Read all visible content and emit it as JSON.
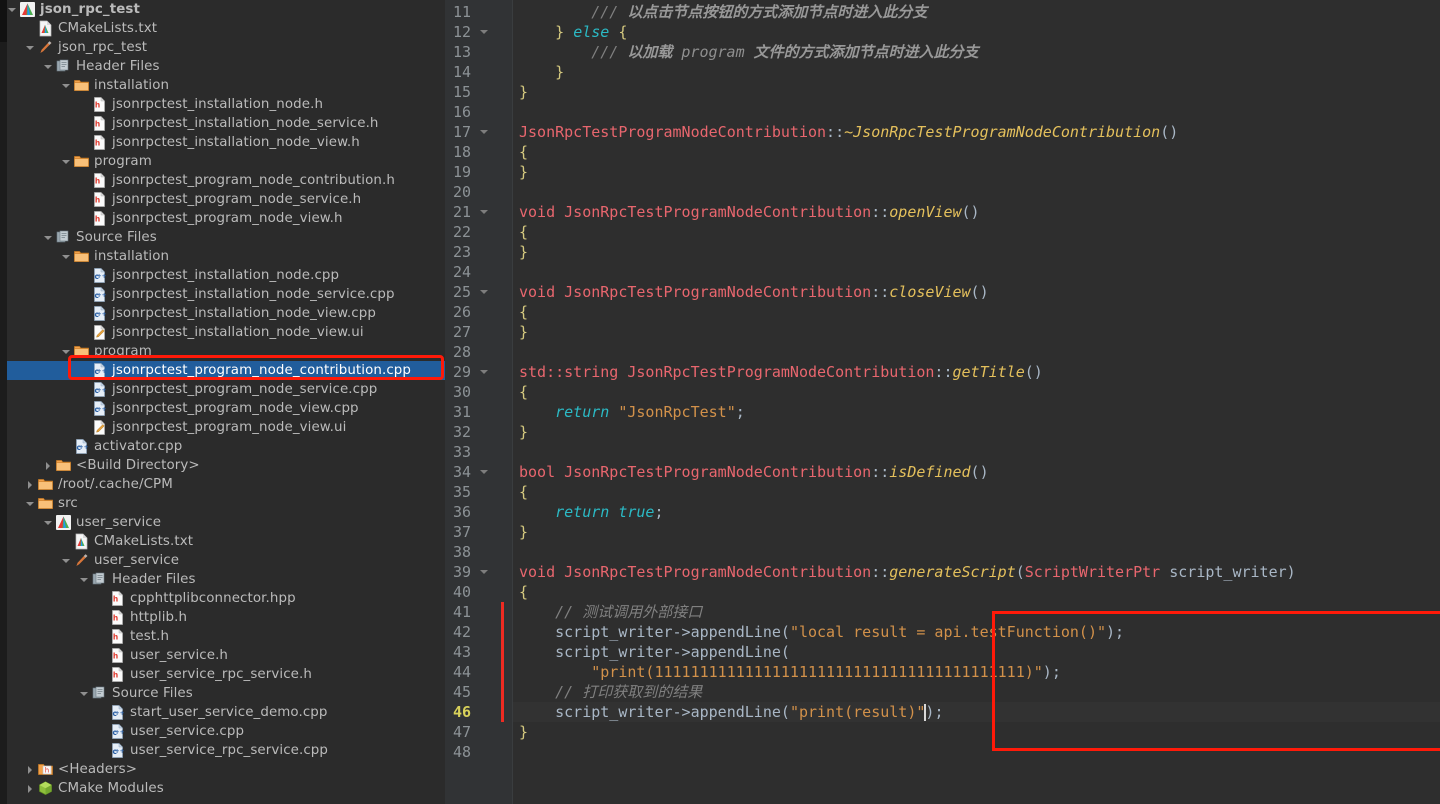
{
  "tree": {
    "rows": [
      {
        "indent": 0,
        "arrow": "down",
        "icon": "cmake-project-icon",
        "label": "json_rpc_test",
        "bold": true,
        "selected": false
      },
      {
        "indent": 1,
        "arrow": "none",
        "icon": "cmake-file-icon",
        "label": "CMakeLists.txt",
        "bold": false,
        "selected": false
      },
      {
        "indent": 1,
        "arrow": "down",
        "icon": "build-target-icon",
        "label": "json_rpc_test",
        "bold": false,
        "selected": false
      },
      {
        "indent": 2,
        "arrow": "down",
        "icon": "header-group-icon",
        "label": "Header Files",
        "bold": false,
        "selected": false
      },
      {
        "indent": 3,
        "arrow": "down",
        "icon": "folder-icon",
        "label": "installation",
        "bold": false,
        "selected": false
      },
      {
        "indent": 4,
        "arrow": "none",
        "icon": "h-file-icon",
        "label": "jsonrpctest_installation_node.h",
        "bold": false,
        "selected": false
      },
      {
        "indent": 4,
        "arrow": "none",
        "icon": "h-file-icon",
        "label": "jsonrpctest_installation_node_service.h",
        "bold": false,
        "selected": false
      },
      {
        "indent": 4,
        "arrow": "none",
        "icon": "h-file-icon",
        "label": "jsonrpctest_installation_node_view.h",
        "bold": false,
        "selected": false
      },
      {
        "indent": 3,
        "arrow": "down",
        "icon": "folder-icon",
        "label": "program",
        "bold": false,
        "selected": false
      },
      {
        "indent": 4,
        "arrow": "none",
        "icon": "h-file-icon",
        "label": "jsonrpctest_program_node_contribution.h",
        "bold": false,
        "selected": false
      },
      {
        "indent": 4,
        "arrow": "none",
        "icon": "h-file-icon",
        "label": "jsonrpctest_program_node_service.h",
        "bold": false,
        "selected": false
      },
      {
        "indent": 4,
        "arrow": "none",
        "icon": "h-file-icon",
        "label": "jsonrpctest_program_node_view.h",
        "bold": false,
        "selected": false
      },
      {
        "indent": 2,
        "arrow": "down",
        "icon": "source-group-icon",
        "label": "Source Files",
        "bold": false,
        "selected": false
      },
      {
        "indent": 3,
        "arrow": "down",
        "icon": "folder-icon",
        "label": "installation",
        "bold": false,
        "selected": false
      },
      {
        "indent": 4,
        "arrow": "none",
        "icon": "cpp-file-icon",
        "label": "jsonrpctest_installation_node.cpp",
        "bold": false,
        "selected": false
      },
      {
        "indent": 4,
        "arrow": "none",
        "icon": "cpp-file-icon",
        "label": "jsonrpctest_installation_node_service.cpp",
        "bold": false,
        "selected": false
      },
      {
        "indent": 4,
        "arrow": "none",
        "icon": "cpp-file-icon",
        "label": "jsonrpctest_installation_node_view.cpp",
        "bold": false,
        "selected": false
      },
      {
        "indent": 4,
        "arrow": "none",
        "icon": "ui-file-icon",
        "label": "jsonrpctest_installation_node_view.ui",
        "bold": false,
        "selected": false
      },
      {
        "indent": 3,
        "arrow": "down",
        "icon": "folder-icon",
        "label": "program",
        "bold": false,
        "selected": false
      },
      {
        "indent": 4,
        "arrow": "none",
        "icon": "cpp-file-icon",
        "label": "jsonrpctest_program_node_contribution.cpp",
        "bold": false,
        "selected": true
      },
      {
        "indent": 4,
        "arrow": "none",
        "icon": "cpp-file-icon",
        "label": "jsonrpctest_program_node_service.cpp",
        "bold": false,
        "selected": false
      },
      {
        "indent": 4,
        "arrow": "none",
        "icon": "cpp-file-icon",
        "label": "jsonrpctest_program_node_view.cpp",
        "bold": false,
        "selected": false
      },
      {
        "indent": 4,
        "arrow": "none",
        "icon": "ui-file-icon",
        "label": "jsonrpctest_program_node_view.ui",
        "bold": false,
        "selected": false
      },
      {
        "indent": 3,
        "arrow": "none",
        "icon": "cpp-file-icon",
        "label": "activator.cpp",
        "bold": false,
        "selected": false
      },
      {
        "indent": 2,
        "arrow": "right",
        "icon": "folder-icon",
        "label": "<Build Directory>",
        "bold": false,
        "selected": false
      },
      {
        "indent": 1,
        "arrow": "right",
        "icon": "folder-icon",
        "label": "/root/.cache/CPM",
        "bold": false,
        "selected": false
      },
      {
        "indent": 1,
        "arrow": "down",
        "icon": "folder-icon",
        "label": "src",
        "bold": false,
        "selected": false
      },
      {
        "indent": 2,
        "arrow": "down",
        "icon": "cmake-project-icon",
        "label": "user_service",
        "bold": false,
        "selected": false
      },
      {
        "indent": 3,
        "arrow": "none",
        "icon": "cmake-file-icon",
        "label": "CMakeLists.txt",
        "bold": false,
        "selected": false
      },
      {
        "indent": 3,
        "arrow": "down",
        "icon": "build-target-icon",
        "label": "user_service",
        "bold": false,
        "selected": false
      },
      {
        "indent": 4,
        "arrow": "down",
        "icon": "header-group-icon",
        "label": "Header Files",
        "bold": false,
        "selected": false
      },
      {
        "indent": 5,
        "arrow": "none",
        "icon": "h-file-icon",
        "label": "cpphttplibconnector.hpp",
        "bold": false,
        "selected": false
      },
      {
        "indent": 5,
        "arrow": "none",
        "icon": "h-file-icon",
        "label": "httplib.h",
        "bold": false,
        "selected": false
      },
      {
        "indent": 5,
        "arrow": "none",
        "icon": "h-file-icon",
        "label": "test.h",
        "bold": false,
        "selected": false
      },
      {
        "indent": 5,
        "arrow": "none",
        "icon": "h-file-icon",
        "label": "user_service.h",
        "bold": false,
        "selected": false
      },
      {
        "indent": 5,
        "arrow": "none",
        "icon": "h-file-icon",
        "label": "user_service_rpc_service.h",
        "bold": false,
        "selected": false
      },
      {
        "indent": 4,
        "arrow": "down",
        "icon": "source-group-icon",
        "label": "Source Files",
        "bold": false,
        "selected": false
      },
      {
        "indent": 5,
        "arrow": "none",
        "icon": "cpp-file-icon",
        "label": "start_user_service_demo.cpp",
        "bold": false,
        "selected": false
      },
      {
        "indent": 5,
        "arrow": "none",
        "icon": "cpp-file-icon",
        "label": "user_service.cpp",
        "bold": false,
        "selected": false
      },
      {
        "indent": 5,
        "arrow": "none",
        "icon": "cpp-file-icon",
        "label": "user_service_rpc_service.cpp",
        "bold": false,
        "selected": false
      },
      {
        "indent": 1,
        "arrow": "right",
        "icon": "headers-group-icon",
        "label": "<Headers>",
        "bold": false,
        "selected": false
      },
      {
        "indent": 1,
        "arrow": "right",
        "icon": "cmake-modules-icon",
        "label": "CMake Modules",
        "bold": false,
        "selected": false
      }
    ],
    "selection_highlight_color": "#215d9c",
    "annotation_box_color": "#ff1a09"
  },
  "editor": {
    "first_line_number": 11,
    "last_line_number": 48,
    "current_line_number": 46,
    "change_bar_color": "#ee2b22",
    "annotation_box_color": "#ff1a09",
    "lines": [
      {
        "n": 11,
        "fold": false,
        "tokens": [
          {
            "t": "        ",
            "c": "plain"
          },
          {
            "t": "/// ",
            "c": "cmt"
          },
          {
            "t": "以点击节点按钮的方式添加节点时进入此分支",
            "c": "docc"
          }
        ]
      },
      {
        "n": 12,
        "fold": true,
        "tokens": [
          {
            "t": "    ",
            "c": "plain"
          },
          {
            "t": "}",
            "c": "brace-y"
          },
          {
            "t": " ",
            "c": "plain"
          },
          {
            "t": "else",
            "c": "kw2"
          },
          {
            "t": " ",
            "c": "plain"
          },
          {
            "t": "{",
            "c": "brace-y"
          }
        ]
      },
      {
        "n": 13,
        "fold": false,
        "tokens": [
          {
            "t": "        ",
            "c": "plain"
          },
          {
            "t": "/// ",
            "c": "cmt"
          },
          {
            "t": "以加载 ",
            "c": "docc"
          },
          {
            "t": "program",
            "c": "doct"
          },
          {
            "t": " 文件的方式添加节点时进入此分支",
            "c": "docc"
          }
        ]
      },
      {
        "n": 14,
        "fold": false,
        "tokens": [
          {
            "t": "    ",
            "c": "plain"
          },
          {
            "t": "}",
            "c": "brace-y"
          }
        ]
      },
      {
        "n": 15,
        "fold": false,
        "tokens": [
          {
            "t": "}",
            "c": "brace-y"
          }
        ]
      },
      {
        "n": 16,
        "fold": false,
        "tokens": []
      },
      {
        "n": 17,
        "fold": true,
        "tokens": [
          {
            "t": "JsonRpcTestProgramNodeContribution",
            "c": "type"
          },
          {
            "t": "::",
            "c": "pun"
          },
          {
            "t": "~JsonRpcTestProgramNodeContribution",
            "c": "fn"
          },
          {
            "t": "()",
            "c": "pun"
          }
        ]
      },
      {
        "n": 18,
        "fold": false,
        "tokens": [
          {
            "t": "{",
            "c": "brace-y"
          }
        ]
      },
      {
        "n": 19,
        "fold": false,
        "tokens": [
          {
            "t": "}",
            "c": "brace-y"
          }
        ]
      },
      {
        "n": 20,
        "fold": false,
        "tokens": []
      },
      {
        "n": 21,
        "fold": true,
        "tokens": [
          {
            "t": "void",
            "c": "type"
          },
          {
            "t": " ",
            "c": "plain"
          },
          {
            "t": "JsonRpcTestProgramNodeContribution",
            "c": "type"
          },
          {
            "t": "::",
            "c": "pun"
          },
          {
            "t": "openView",
            "c": "fn"
          },
          {
            "t": "()",
            "c": "pun"
          }
        ]
      },
      {
        "n": 22,
        "fold": false,
        "tokens": [
          {
            "t": "{",
            "c": "brace-y"
          }
        ]
      },
      {
        "n": 23,
        "fold": false,
        "tokens": [
          {
            "t": "}",
            "c": "brace-y"
          }
        ]
      },
      {
        "n": 24,
        "fold": false,
        "tokens": []
      },
      {
        "n": 25,
        "fold": true,
        "tokens": [
          {
            "t": "void",
            "c": "type"
          },
          {
            "t": " ",
            "c": "plain"
          },
          {
            "t": "JsonRpcTestProgramNodeContribution",
            "c": "type"
          },
          {
            "t": "::",
            "c": "pun"
          },
          {
            "t": "closeView",
            "c": "fn"
          },
          {
            "t": "()",
            "c": "pun"
          }
        ]
      },
      {
        "n": 26,
        "fold": false,
        "tokens": [
          {
            "t": "{",
            "c": "brace-y"
          }
        ]
      },
      {
        "n": 27,
        "fold": false,
        "tokens": [
          {
            "t": "}",
            "c": "brace-y"
          }
        ]
      },
      {
        "n": 28,
        "fold": false,
        "tokens": []
      },
      {
        "n": 29,
        "fold": true,
        "tokens": [
          {
            "t": "std::string",
            "c": "type"
          },
          {
            "t": " ",
            "c": "plain"
          },
          {
            "t": "JsonRpcTestProgramNodeContribution",
            "c": "type"
          },
          {
            "t": "::",
            "c": "pun"
          },
          {
            "t": "getTitle",
            "c": "fn"
          },
          {
            "t": "()",
            "c": "pun"
          }
        ]
      },
      {
        "n": 30,
        "fold": false,
        "tokens": [
          {
            "t": "{",
            "c": "brace-y"
          }
        ]
      },
      {
        "n": 31,
        "fold": false,
        "tokens": [
          {
            "t": "    ",
            "c": "plain"
          },
          {
            "t": "return",
            "c": "kw2"
          },
          {
            "t": " ",
            "c": "plain"
          },
          {
            "t": "\"JsonRpcTest\"",
            "c": "str"
          },
          {
            "t": ";",
            "c": "pun"
          }
        ]
      },
      {
        "n": 32,
        "fold": false,
        "tokens": [
          {
            "t": "}",
            "c": "brace-y"
          }
        ]
      },
      {
        "n": 33,
        "fold": false,
        "tokens": []
      },
      {
        "n": 34,
        "fold": true,
        "tokens": [
          {
            "t": "bool",
            "c": "type"
          },
          {
            "t": " ",
            "c": "plain"
          },
          {
            "t": "JsonRpcTestProgramNodeContribution",
            "c": "type"
          },
          {
            "t": "::",
            "c": "pun"
          },
          {
            "t": "isDefined",
            "c": "fn"
          },
          {
            "t": "()",
            "c": "pun"
          }
        ]
      },
      {
        "n": 35,
        "fold": false,
        "tokens": [
          {
            "t": "{",
            "c": "brace-y"
          }
        ]
      },
      {
        "n": 36,
        "fold": false,
        "tokens": [
          {
            "t": "    ",
            "c": "plain"
          },
          {
            "t": "return",
            "c": "kw2"
          },
          {
            "t": " ",
            "c": "plain"
          },
          {
            "t": "true",
            "c": "kw2"
          },
          {
            "t": ";",
            "c": "pun"
          }
        ]
      },
      {
        "n": 37,
        "fold": false,
        "tokens": [
          {
            "t": "}",
            "c": "brace-y"
          }
        ]
      },
      {
        "n": 38,
        "fold": false,
        "tokens": []
      },
      {
        "n": 39,
        "fold": true,
        "tokens": [
          {
            "t": "void",
            "c": "type"
          },
          {
            "t": " ",
            "c": "plain"
          },
          {
            "t": "JsonRpcTestProgramNodeContribution",
            "c": "type"
          },
          {
            "t": "::",
            "c": "pun"
          },
          {
            "t": "generateScript",
            "c": "fn"
          },
          {
            "t": "(",
            "c": "pun"
          },
          {
            "t": "ScriptWriterPtr",
            "c": "type"
          },
          {
            "t": " script_writer",
            "c": "plain"
          },
          {
            "t": ")",
            "c": "pun"
          }
        ]
      },
      {
        "n": 40,
        "fold": false,
        "tokens": [
          {
            "t": "{",
            "c": "brace-y"
          }
        ]
      },
      {
        "n": 41,
        "fold": false,
        "tokens": [
          {
            "t": "    ",
            "c": "plain"
          },
          {
            "t": "// 测试调用外部接口",
            "c": "cmt"
          }
        ]
      },
      {
        "n": 42,
        "fold": false,
        "tokens": [
          {
            "t": "    script_writer->appendLine",
            "c": "plain"
          },
          {
            "t": "(",
            "c": "pun"
          },
          {
            "t": "\"local result = api.testFunction()\"",
            "c": "str"
          },
          {
            "t": ")",
            "c": "pun"
          },
          {
            "t": ";",
            "c": "pun"
          }
        ]
      },
      {
        "n": 43,
        "fold": false,
        "tokens": [
          {
            "t": "    script_writer->appendLine",
            "c": "plain"
          },
          {
            "t": "(",
            "c": "pun"
          }
        ]
      },
      {
        "n": 44,
        "fold": false,
        "tokens": [
          {
            "t": "        ",
            "c": "plain"
          },
          {
            "t": "\"print(11111111111111111111111111111111111111111)\"",
            "c": "str"
          },
          {
            "t": ")",
            "c": "pun"
          },
          {
            "t": ";",
            "c": "pun"
          }
        ]
      },
      {
        "n": 45,
        "fold": false,
        "tokens": [
          {
            "t": "    ",
            "c": "plain"
          },
          {
            "t": "// 打印获取到的结果",
            "c": "cmt"
          }
        ]
      },
      {
        "n": 46,
        "fold": false,
        "tokens": [
          {
            "t": "    script_writer->appendLine",
            "c": "plain"
          },
          {
            "t": "(",
            "c": "pun"
          },
          {
            "t": "\"print(result)\"",
            "c": "str"
          },
          {
            "t": ")",
            "c": "pun"
          },
          {
            "t": ";",
            "c": "pun"
          }
        ]
      },
      {
        "n": 47,
        "fold": false,
        "tokens": [
          {
            "t": "}",
            "c": "brace-y"
          }
        ]
      },
      {
        "n": 48,
        "fold": false,
        "tokens": []
      }
    ]
  }
}
